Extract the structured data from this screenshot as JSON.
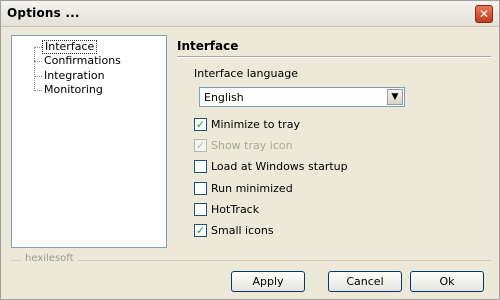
{
  "window": {
    "title": "Options ...",
    "close_icon": "close-icon"
  },
  "tree": {
    "items": [
      {
        "label": "Interface",
        "selected": true
      },
      {
        "label": "Confirmations",
        "selected": false
      },
      {
        "label": "Integration",
        "selected": false
      },
      {
        "label": "Monitoring",
        "selected": false
      }
    ]
  },
  "panel": {
    "title": "Interface",
    "language_label": "Interface language",
    "language_value": "English",
    "checkboxes": [
      {
        "label": "Minimize to tray",
        "checked": true,
        "enabled": true
      },
      {
        "label": "Show tray icon",
        "checked": true,
        "enabled": false
      },
      {
        "label": "Load at Windows startup",
        "checked": false,
        "enabled": true
      },
      {
        "label": "Run minimized",
        "checked": false,
        "enabled": true
      },
      {
        "label": "HotTrack",
        "checked": false,
        "enabled": true
      },
      {
        "label": "Small icons",
        "checked": true,
        "enabled": true
      }
    ]
  },
  "footer": {
    "brand": "hexilesoft"
  },
  "buttons": {
    "apply": "Apply",
    "cancel": "Cancel",
    "ok": "Ok"
  }
}
